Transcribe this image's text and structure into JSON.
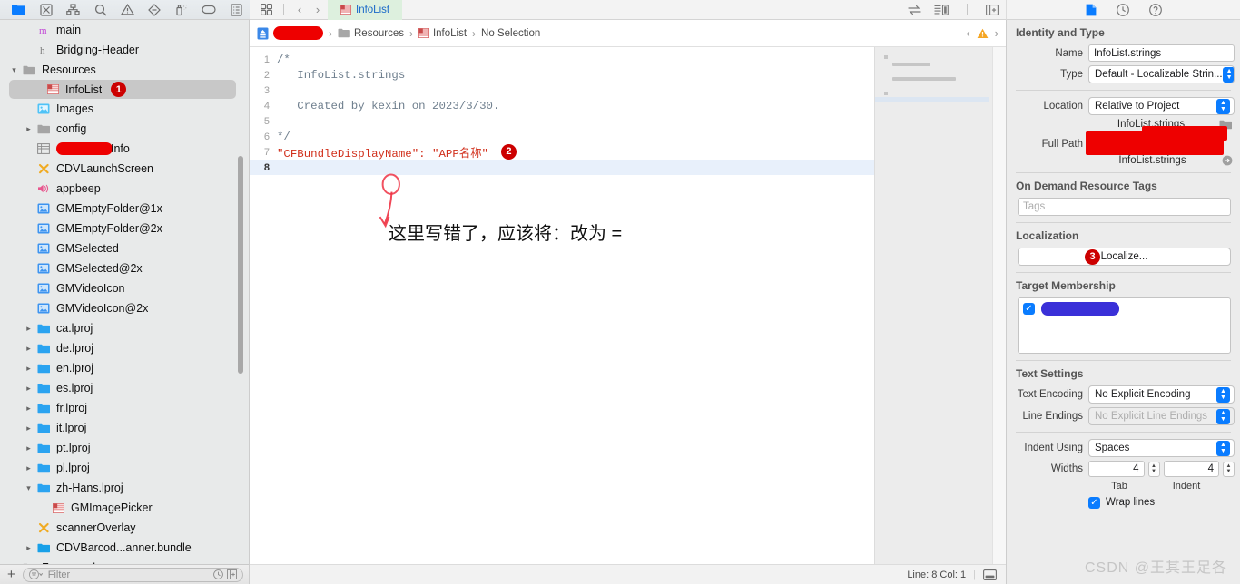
{
  "navigator_toolbar": {
    "icons": [
      {
        "name": "project-navigator-icon",
        "glyph": "folder",
        "selected": true
      },
      {
        "name": "source-control-navigator-icon",
        "glyph": "source-control",
        "selected": false
      },
      {
        "name": "symbol-navigator-icon",
        "glyph": "hierarchy",
        "selected": false
      },
      {
        "name": "find-navigator-icon",
        "glyph": "search",
        "selected": false
      },
      {
        "name": "issue-navigator-icon",
        "glyph": "warning",
        "selected": false
      },
      {
        "name": "test-navigator-icon",
        "glyph": "diamond",
        "selected": false
      },
      {
        "name": "debug-navigator-icon",
        "glyph": "spray",
        "selected": false
      },
      {
        "name": "breakpoint-navigator-icon",
        "glyph": "tag",
        "selected": false
      },
      {
        "name": "report-navigator-icon",
        "glyph": "report",
        "selected": false
      }
    ]
  },
  "editor_toolbar": {
    "grid_icon": "grid-view-icon",
    "back_label": "‹",
    "forward_label": "›",
    "tab_label": "InfoList",
    "right_icons": [
      "code-review-icon",
      "inspector-split-icon",
      "add-editor-icon"
    ]
  },
  "inspector_toolbar": {
    "icons": [
      "file-inspector-icon",
      "history-inspector-icon",
      "quick-help-icon"
    ]
  },
  "navigator": {
    "items": [
      {
        "label": "main",
        "icon": "m-file-icon",
        "indent": 1,
        "twisty": "",
        "selected": false
      },
      {
        "label": "Bridging-Header",
        "icon": "h-file-icon",
        "indent": 1,
        "twisty": "",
        "selected": false
      },
      {
        "label": "Resources",
        "icon": "group-folder-icon",
        "indent": 0,
        "twisty": "⌄",
        "selected": false
      },
      {
        "label": "InfoList",
        "icon": "strings-file-icon",
        "indent": 1,
        "twisty": "",
        "selected": true,
        "badge": "1"
      },
      {
        "label": "Images",
        "icon": "asset-catalog-icon",
        "indent": 1,
        "twisty": "",
        "selected": false
      },
      {
        "label": "config",
        "icon": "group-folder-icon",
        "indent": 1,
        "twisty": "›",
        "selected": false
      },
      {
        "label": "Info",
        "icon": "plist-file-icon",
        "indent": 1,
        "twisty": "",
        "selected": false,
        "redacted": true
      },
      {
        "label": "CDVLaunchScreen",
        "icon": "xib-file-icon",
        "indent": 1,
        "twisty": "",
        "selected": false
      },
      {
        "label": "appbeep",
        "icon": "audio-file-icon",
        "indent": 1,
        "twisty": "",
        "selected": false
      },
      {
        "label": "GMEmptyFolder@1x",
        "icon": "image-file-icon",
        "indent": 1,
        "twisty": "",
        "selected": false
      },
      {
        "label": "GMEmptyFolder@2x",
        "icon": "image-file-icon",
        "indent": 1,
        "twisty": "",
        "selected": false
      },
      {
        "label": "GMSelected",
        "icon": "image-file-icon",
        "indent": 1,
        "twisty": "",
        "selected": false
      },
      {
        "label": "GMSelected@2x",
        "icon": "image-file-icon",
        "indent": 1,
        "twisty": "",
        "selected": false
      },
      {
        "label": "GMVideoIcon",
        "icon": "image-file-icon",
        "indent": 1,
        "twisty": "",
        "selected": false
      },
      {
        "label": "GMVideoIcon@2x",
        "icon": "image-file-icon",
        "indent": 1,
        "twisty": "",
        "selected": false
      },
      {
        "label": "ca.lproj",
        "icon": "blue-folder-icon",
        "indent": 1,
        "twisty": "›",
        "selected": false
      },
      {
        "label": "de.lproj",
        "icon": "blue-folder-icon",
        "indent": 1,
        "twisty": "›",
        "selected": false
      },
      {
        "label": "en.lproj",
        "icon": "blue-folder-icon",
        "indent": 1,
        "twisty": "›",
        "selected": false
      },
      {
        "label": "es.lproj",
        "icon": "blue-folder-icon",
        "indent": 1,
        "twisty": "›",
        "selected": false
      },
      {
        "label": "fr.lproj",
        "icon": "blue-folder-icon",
        "indent": 1,
        "twisty": "›",
        "selected": false
      },
      {
        "label": "it.lproj",
        "icon": "blue-folder-icon",
        "indent": 1,
        "twisty": "›",
        "selected": false
      },
      {
        "label": "pt.lproj",
        "icon": "blue-folder-icon",
        "indent": 1,
        "twisty": "›",
        "selected": false
      },
      {
        "label": "pl.lproj",
        "icon": "blue-folder-icon",
        "indent": 1,
        "twisty": "›",
        "selected": false
      },
      {
        "label": "zh-Hans.lproj",
        "icon": "blue-folder-icon",
        "indent": 1,
        "twisty": "⌄",
        "selected": false
      },
      {
        "label": "GMImagePicker",
        "icon": "strings-file-icon",
        "indent": 2,
        "twisty": "",
        "selected": false
      },
      {
        "label": "scannerOverlay",
        "icon": "xib-file-icon",
        "indent": 1,
        "twisty": "",
        "selected": false
      },
      {
        "label": "CDVBarcod...anner.bundle",
        "icon": "bundle-folder-icon",
        "indent": 1,
        "twisty": "›",
        "selected": false
      },
      {
        "label": "Frameworks",
        "icon": "group-folder-icon",
        "indent": 0,
        "twisty": "⌄",
        "selected": false
      }
    ],
    "bottom_bar": {
      "add_label": "+",
      "filter_placeholder": "Filter",
      "recent_icon": "clock-icon",
      "expand_icon": "expand-icon"
    }
  },
  "jumpbar": {
    "project_redacted": true,
    "group_label": "Resources",
    "file_label": "InfoList",
    "selection_label": "No Selection",
    "warning_icon": "warning-icon",
    "prev_label": "‹",
    "next_label": "›"
  },
  "code": {
    "lines": [
      {
        "n": "1",
        "kind": "comment",
        "text": "/*"
      },
      {
        "n": "2",
        "kind": "comment",
        "text": "   InfoList.strings"
      },
      {
        "n": "3",
        "kind": "comment",
        "text": ""
      },
      {
        "n": "4",
        "kind": "comment",
        "text": "   Created by kexin on 2023/3/30."
      },
      {
        "n": "5",
        "kind": "comment",
        "text": ""
      },
      {
        "n": "6",
        "kind": "comment",
        "text": "*/"
      },
      {
        "n": "7",
        "kind": "string",
        "text": "\"CFBundleDisplayName\": \"APP名称\"",
        "badge": "2"
      },
      {
        "n": "8",
        "kind": "plain",
        "text": "",
        "current": true
      }
    ]
  },
  "annotation": {
    "note": "这里写错了，应该将：改为 =",
    "circle_color": "#ee3344",
    "badge_color": "#cc0000"
  },
  "status_bar": {
    "position": "Line: 8  Col: 1",
    "minimap_toggle_icon": "minimap-toggle-icon"
  },
  "inspector": {
    "identity": {
      "title": "Identity and Type",
      "name_label": "Name",
      "name_value": "InfoList.strings",
      "type_label": "Type",
      "type_value": "Default - Localizable Strin...",
      "location_label": "Location",
      "location_value": "Relative to Project",
      "path_file_top": "InfoList.strings",
      "full_path_label": "Full Path",
      "path_file_bottom": "InfoList.strings",
      "folder_icon": "folder-picker-icon",
      "reveal_icon": "reveal-in-finder-icon"
    },
    "ondemand": {
      "title": "On Demand Resource Tags",
      "tags_placeholder": "Tags"
    },
    "localization": {
      "title": "Localization",
      "button_label": "Localize...",
      "badge": "3"
    },
    "target_membership": {
      "title": "Target Membership",
      "checked": true,
      "target_redacted": true
    },
    "text_settings": {
      "title": "Text Settings",
      "encoding_label": "Text Encoding",
      "encoding_value": "No Explicit Encoding",
      "line_endings_label": "Line Endings",
      "line_endings_value": "No Explicit Line Endings",
      "indent_label": "Indent Using",
      "indent_value": "Spaces",
      "widths_label": "Widths",
      "tab_width": "4",
      "indent_width": "4",
      "tab_caption": "Tab",
      "indent_caption": "Indent",
      "wrap_label": "Wrap lines",
      "wrap_checked": true
    }
  },
  "watermark": "CSDN @王其王足各"
}
